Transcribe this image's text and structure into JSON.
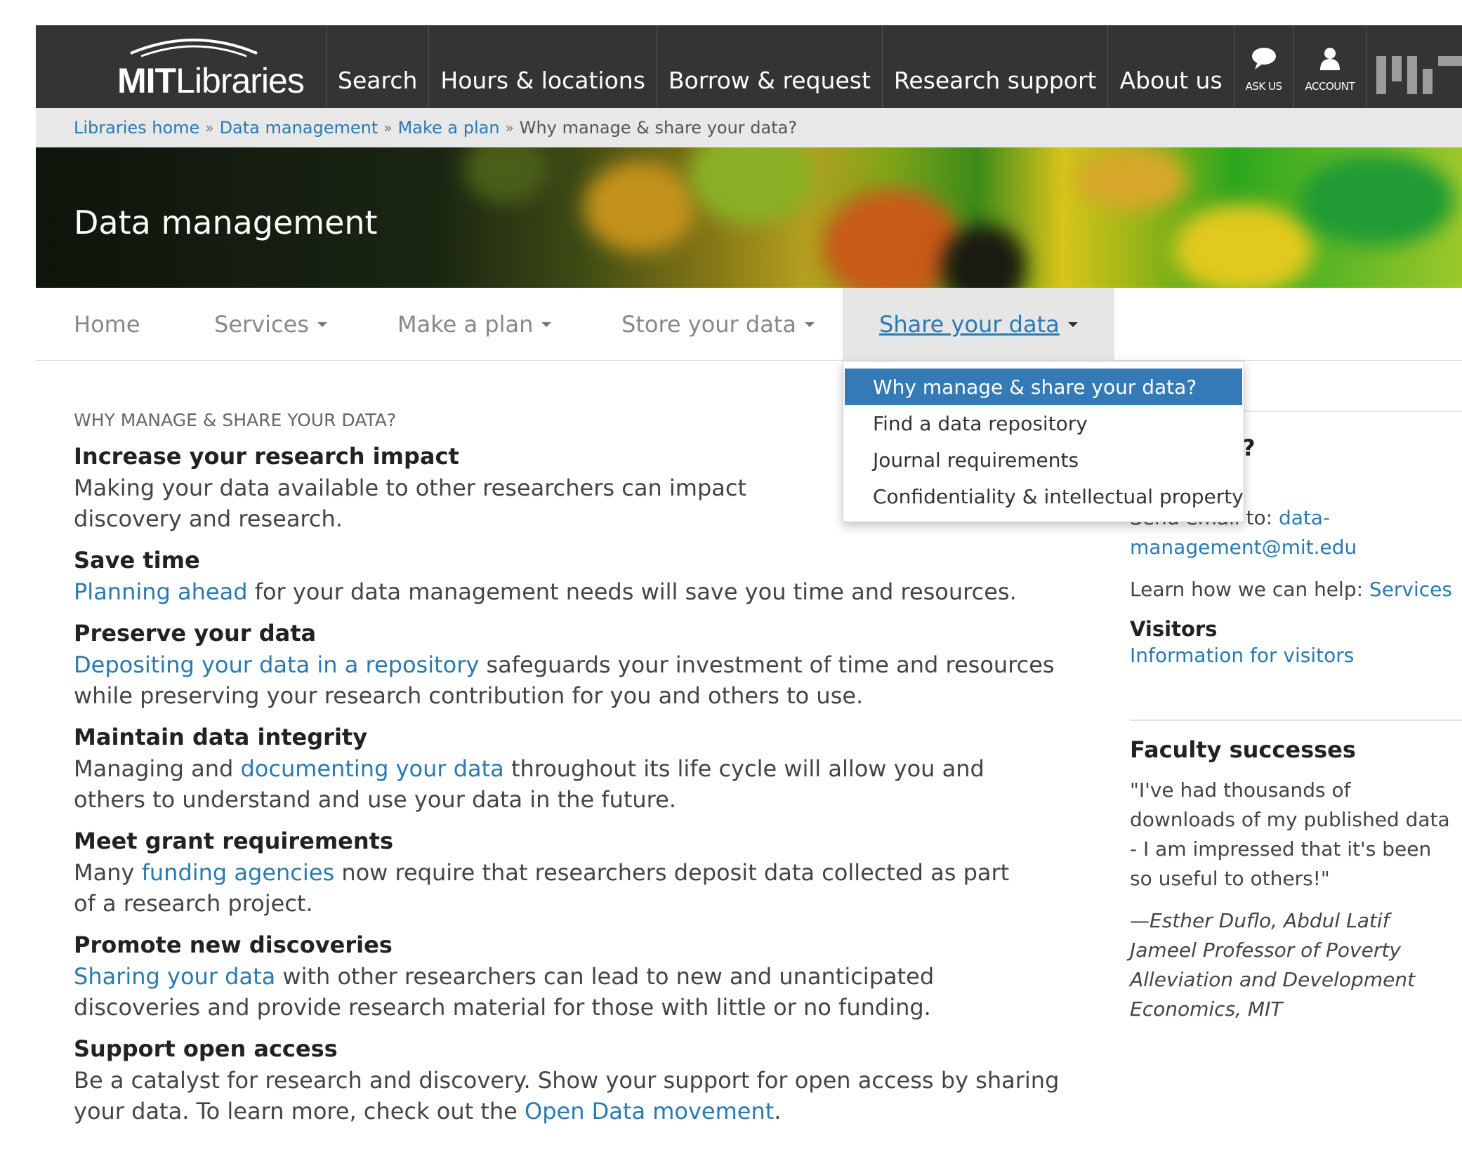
{
  "header": {
    "logo_bold": "MIT",
    "logo_light": "Libraries",
    "nav": [
      "Search",
      "Hours & locations",
      "Borrow & request",
      "Research support",
      "About us"
    ],
    "ask_label": "ASK US",
    "account_label": "ACCOUNT"
  },
  "breadcrumb": {
    "links": [
      "Libraries home",
      "Data management",
      "Make a plan"
    ],
    "current": "Why manage & share your data?"
  },
  "hero": {
    "title": "Data management"
  },
  "subnav": {
    "home": "Home",
    "services": "Services",
    "make_plan": "Make a plan",
    "store": "Store your data",
    "share": "Share your data"
  },
  "dropdown": {
    "items": [
      "Why manage & share your data?",
      "Find a data repository",
      "Journal requirements",
      "Confidentiality & intellectual property"
    ]
  },
  "main": {
    "section_label": "WHY MANAGE & SHARE YOUR DATA?",
    "items": [
      {
        "heading": "Increase your research impact",
        "pre": "Making your data available to other researchers can impact discovery and",
        "link": "",
        "post": " research."
      },
      {
        "heading": "Save time",
        "pre": "",
        "link": "Planning ahead",
        "post": " for your data management needs will save you time and resources."
      },
      {
        "heading": "Preserve your data",
        "pre": "",
        "link": "Depositing your data in a repository",
        "post": " safeguards your investment of time and resources while preserving your research contribution for you and others to use."
      },
      {
        "heading": "Maintain data integrity",
        "pre": "Managing and ",
        "link": "documenting your data",
        "post": " throughout its life cycle will allow you and others to understand and use your data in the future."
      },
      {
        "heading": "Meet grant requirements",
        "pre": "Many ",
        "link": "funding agencies",
        "post": " now require that researchers deposit data collected as part of a research project."
      },
      {
        "heading": "Promote new discoveries",
        "pre": "",
        "link": "Sharing your data",
        "post": " with other researchers can lead to new and unanticipated discoveries and provide research material for those with little or no funding."
      },
      {
        "heading": "Support open access",
        "pre": "Be a catalyst for research and discovery. Show your support for open access by sharing your data. To learn more, check out the ",
        "link": "Open Data movement",
        "post": "."
      }
    ]
  },
  "sidebar": {
    "question_tail": "?",
    "email_prefix": "Send email to: ",
    "email_link": "data-management@mit.edu",
    "help_prefix": "Learn how we can help: ",
    "help_link": "Services",
    "visitors_heading": "Visitors",
    "visitors_link": "Information for visitors",
    "faculty_heading": "Faculty successes",
    "quote": "\"I've had thousands of downloads of my published data - I am impressed that it's been so useful to others!\"",
    "attribution": "—Esther Duflo, Abdul Latif Jameel Professor of Poverty Alleviation and Development Economics, MIT"
  },
  "colors": {
    "header_bg": "#343434",
    "link": "#2a7ab0",
    "dropdown_selected": "#337ab7",
    "breadcrumb_bg": "#e8e8e8"
  }
}
